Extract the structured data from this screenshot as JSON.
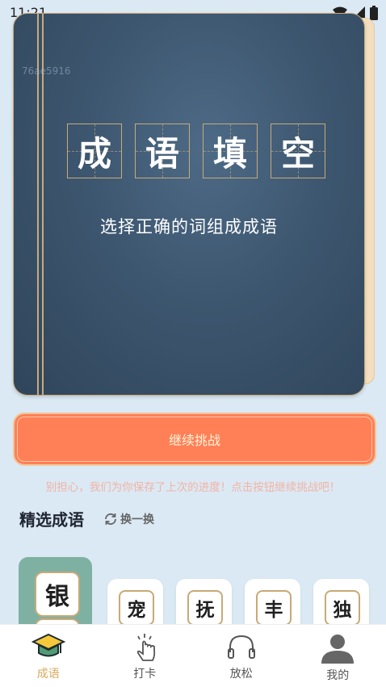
{
  "status_bar": {
    "time": "11:21",
    "icons": [
      "wifi-icon",
      "signal-icon",
      "battery-icon"
    ]
  },
  "book": {
    "watermark": "76ae5916",
    "title_chars": [
      "成",
      "语",
      "填",
      "空"
    ],
    "subtitle": "选择正确的词组成成语"
  },
  "continue_button": {
    "label": "继续挑战"
  },
  "hint": "别担心，我们为你保存了上次的进度！点击按钮继续挑战吧！",
  "featured": {
    "title": "精选成语",
    "refresh_label": "换一换",
    "items": [
      "银",
      "宠",
      "抚",
      "丰",
      "独"
    ]
  },
  "bottom_nav": [
    {
      "label": "成语",
      "icon": "graduation-cap-icon",
      "active": true
    },
    {
      "label": "打卡",
      "icon": "tap-hand-icon",
      "active": false
    },
    {
      "label": "放松",
      "icon": "headphones-icon",
      "active": false
    },
    {
      "label": "我的",
      "icon": "user-icon",
      "active": false
    }
  ],
  "colors": {
    "background": "#dbe9f4",
    "accent": "#ff7f57",
    "book": "#3d566f",
    "nav_active": "#d9a85b"
  }
}
